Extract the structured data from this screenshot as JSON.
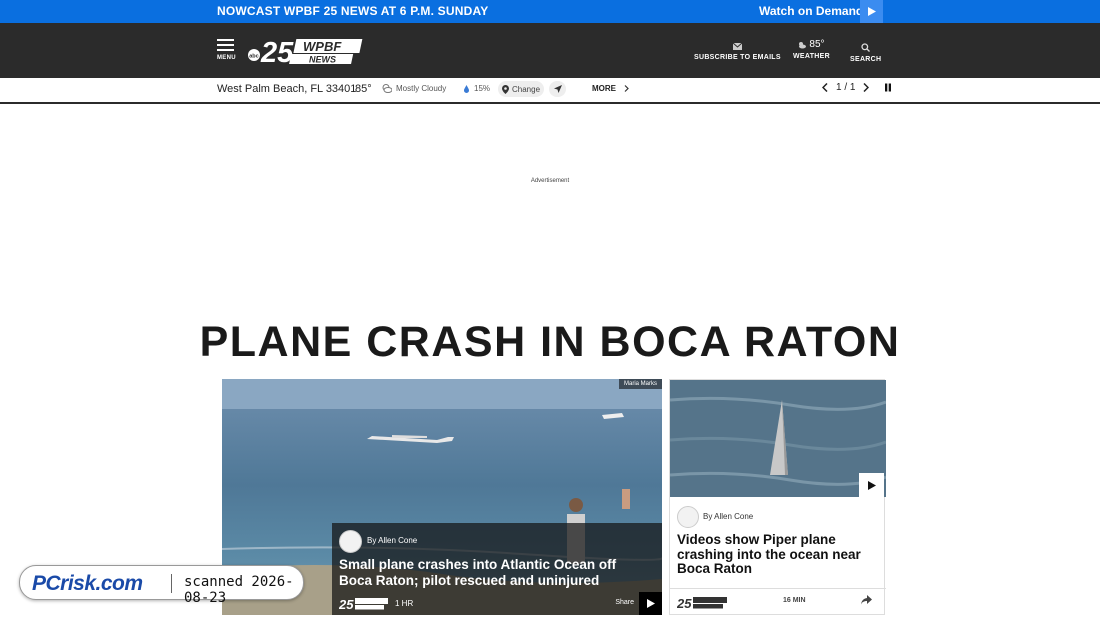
{
  "top_banner": {
    "live_label": "NOWCAST WPBF 25 News at 6 p.m. Sunday",
    "watch_label": "Watch on Demand"
  },
  "header": {
    "menu_label": "MENU",
    "logo_text": "25 WPBF NEWS",
    "logo_network": "abc",
    "subscribe_label": "SUBSCRIBE TO EMAILS",
    "weather_temp": "85°",
    "weather_label": "WEATHER",
    "search_label": "SEARCH"
  },
  "weather_bar": {
    "location": "West Palm Beach, FL 33401",
    "temperature": "85°",
    "condition": "Mostly Cloudy",
    "precip": "15%",
    "change_label": "Change",
    "more_label": "MORE",
    "pager": "1 / 1"
  },
  "ad": {
    "label": "Advertisement"
  },
  "section": {
    "headline": "PLANE CRASH IN BOCA RATON"
  },
  "lead_story": {
    "photo_credit": "Maria Marks",
    "byline": "By Allen Cone",
    "title": "Small plane crashes into Atlantic Ocean off Boca Raton; pilot rescued and uninjured",
    "logo_text": "25 WPBF NEWS",
    "time": "1 HR",
    "share_label": "Share"
  },
  "side_story": {
    "byline": "By Allen Cone",
    "title": "Videos show Piper plane crashing into the ocean near Boca Raton",
    "logo_text": "25 WPBF NEWS",
    "time": "16 MIN"
  },
  "watermark": {
    "brand": "PCrisk.com",
    "scan_text": "scanned 2026-08-23"
  },
  "colors": {
    "top_banner": "#0a6fe0",
    "header": "#2b2b2b"
  }
}
